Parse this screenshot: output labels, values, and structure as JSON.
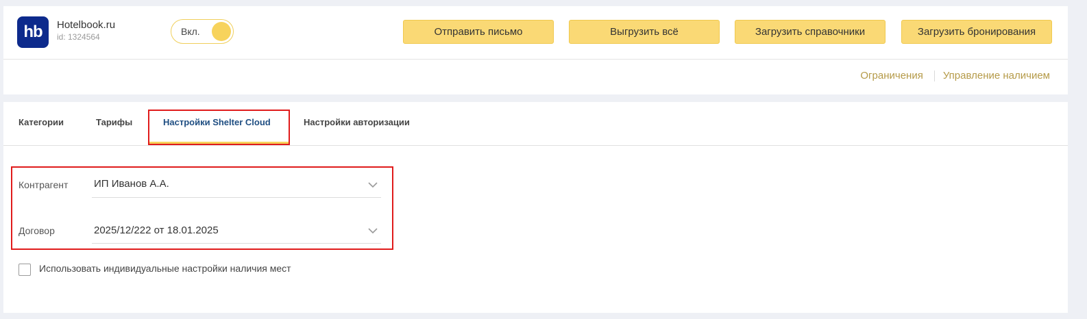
{
  "header": {
    "logo_text": "hb",
    "brand_name": "Hotelbook.ru",
    "brand_id": "id: 1324564",
    "toggle_label": "Вкл.",
    "buttons": {
      "send_letter": "Отправить письмо",
      "export_all": "Выгрузить всё",
      "load_references": "Загрузить справочники",
      "load_bookings": "Загрузить бронирования"
    },
    "links": {
      "restrictions": "Ограничения",
      "availability": "Управление наличием"
    }
  },
  "tabs": {
    "categories": "Категории",
    "rates": "Тарифы",
    "shelter": "Настройки Shelter Cloud",
    "auth": "Настройки авторизации"
  },
  "form": {
    "counterparty_label": "Контрагент",
    "counterparty_value": "ИП Иванов А.А.",
    "contract_label": "Договор",
    "contract_value": "2025/12/222 от 18.01.2025",
    "checkbox_label": "Использовать индивидуальные настройки наличия мест"
  },
  "colors": {
    "accent": "#fad975",
    "brand": "#0d2a8c",
    "active_tab": "#1f4e82",
    "link": "#b59a48",
    "highlight": "#e01a1a"
  }
}
